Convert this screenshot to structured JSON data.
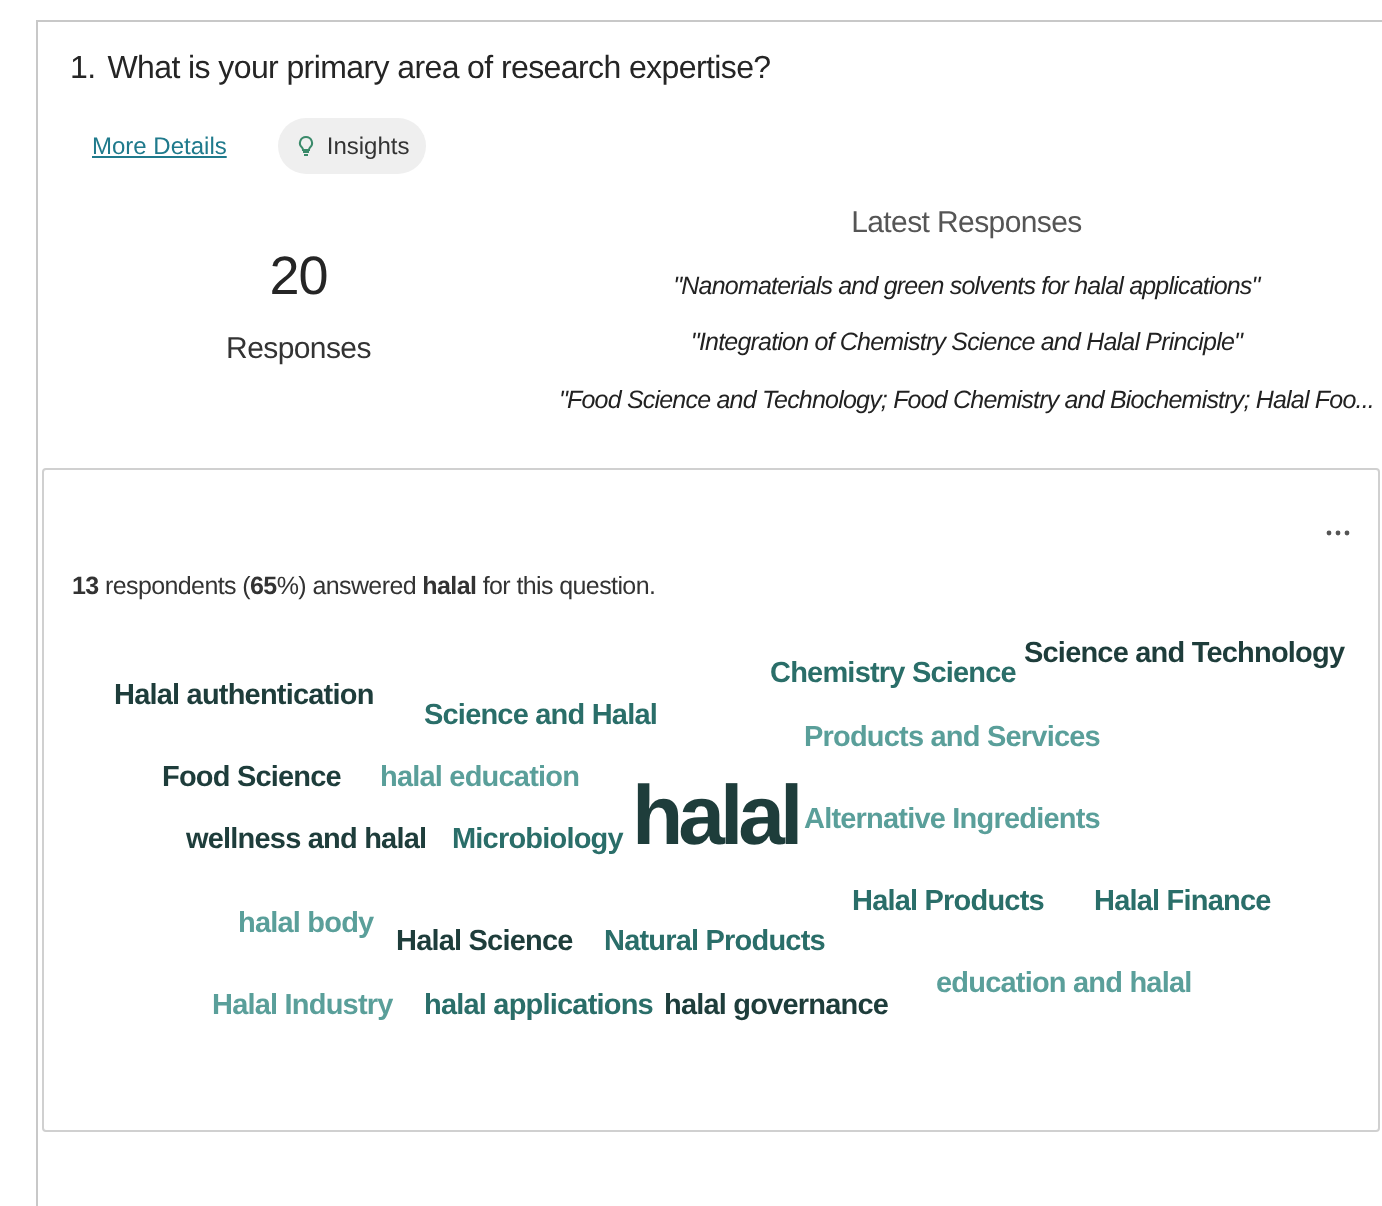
{
  "question": {
    "number": "1.",
    "text": "What is your primary area of research expertise?"
  },
  "links": {
    "more_details": "More Details",
    "insights": "Insights"
  },
  "summary": {
    "count": "20",
    "label": "Responses"
  },
  "latest": {
    "title": "Latest Responses",
    "items": [
      "\"Nanomaterials and green solvents for halal applications\"",
      "\"Integration of Chemistry Science and Halal Principle\"",
      "\"Food Science and Technology; Food Chemistry and Biochemistry; Halal Foo..."
    ]
  },
  "insight": {
    "sentence": "**13** respondents (**65**%) answered **halal** for this question.",
    "words": [
      {
        "text": "Halal authentication",
        "kind": "term",
        "color": "#1e3d3b"
      },
      {
        "text": "Science and Halal",
        "kind": "term",
        "color": "#2a6e69"
      },
      {
        "text": "Chemistry Science",
        "kind": "term",
        "color": "#2a6e69"
      },
      {
        "text": "Science and Technology",
        "kind": "term",
        "color": "#1e3d3b"
      },
      {
        "text": "Products and Services",
        "kind": "term",
        "color": "#5a9f9a"
      },
      {
        "text": "Food Science",
        "kind": "term",
        "color": "#1e3d3b"
      },
      {
        "text": "halal education",
        "kind": "term",
        "color": "#5a9f9a"
      },
      {
        "text": "halal",
        "kind": "main",
        "color": "#1e3d3b"
      },
      {
        "text": "Alternative Ingredients",
        "kind": "term",
        "color": "#5a9f9a"
      },
      {
        "text": "wellness and halal",
        "kind": "term",
        "color": "#1e3d3b"
      },
      {
        "text": "Microbiology",
        "kind": "term",
        "color": "#2a6e69"
      },
      {
        "text": "Halal Products",
        "kind": "term",
        "color": "#2a6e69"
      },
      {
        "text": "Halal Finance",
        "kind": "term",
        "color": "#2a6e69"
      },
      {
        "text": "halal body",
        "kind": "term",
        "color": "#5a9f9a"
      },
      {
        "text": "Halal Science",
        "kind": "term",
        "color": "#1e3d3b"
      },
      {
        "text": "Natural Products",
        "kind": "term",
        "color": "#2a6e69"
      },
      {
        "text": "education and halal",
        "kind": "term",
        "color": "#5a9f9a"
      },
      {
        "text": "Halal Industry",
        "kind": "term",
        "color": "#5a9f9a"
      },
      {
        "text": "halal applications",
        "kind": "term",
        "color": "#2a6e69"
      },
      {
        "text": "halal governance",
        "kind": "term",
        "color": "#1e3d3b"
      }
    ]
  }
}
